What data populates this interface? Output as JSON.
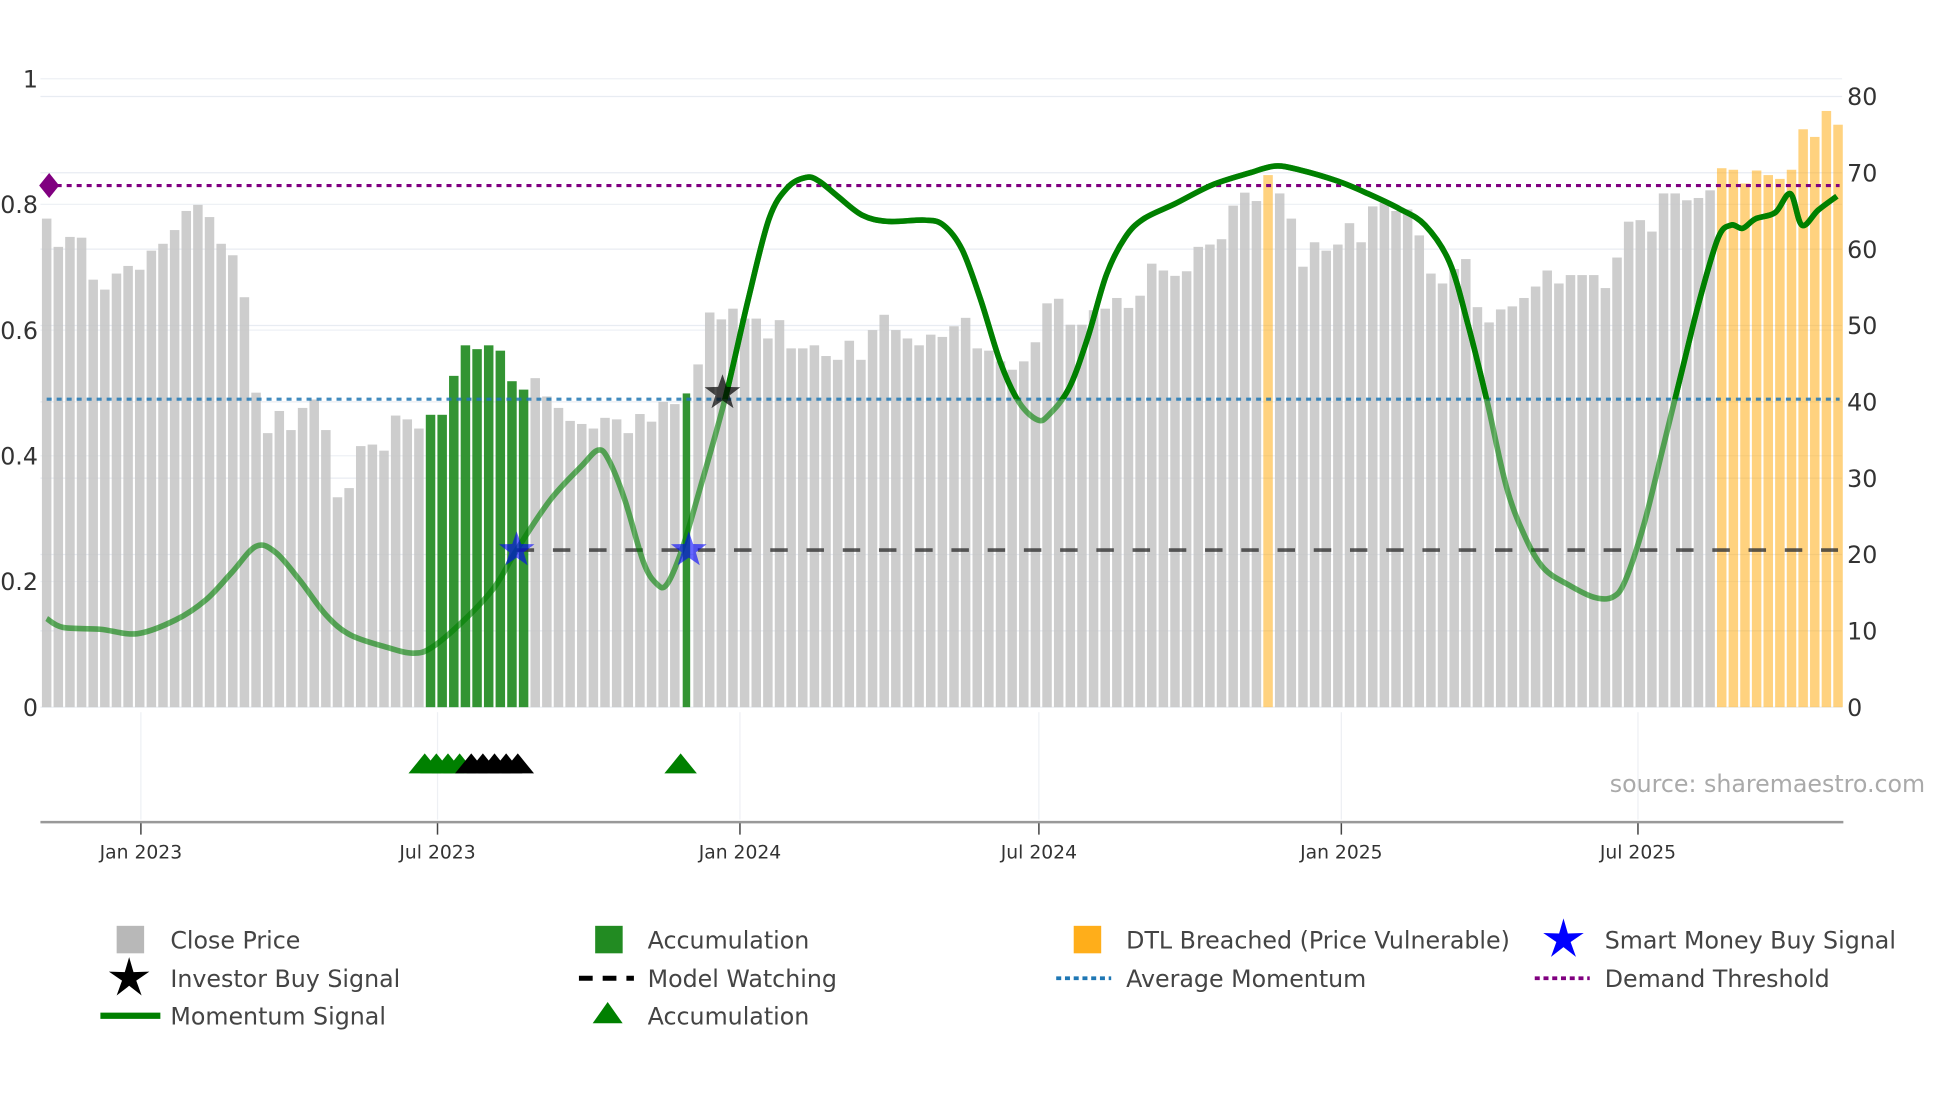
{
  "chart_data": {
    "type": "bar",
    "title": "",
    "xlabel": "",
    "ylabel_left": "",
    "ylabel_right": "",
    "source_note": "source: sharemaestro.com",
    "left_axis": {
      "range": [
        0,
        1
      ],
      "ticks": [
        "0",
        "0.2",
        "0.4",
        "0.6",
        "0.8",
        "1"
      ],
      "tick_values": [
        0,
        0.2,
        0.4,
        0.6,
        0.8,
        1
      ]
    },
    "right_axis": {
      "range": [
        0,
        80
      ],
      "ticks": [
        "0",
        "10",
        "20",
        "30",
        "40",
        "50",
        "60",
        "70",
        "80"
      ],
      "tick_values": [
        0,
        10,
        20,
        30,
        40,
        50,
        60,
        70,
        80
      ]
    },
    "x_axis": {
      "unit": "weekly bar index",
      "ticks": [
        {
          "label": "Jan 2023",
          "index": 8.1
        },
        {
          "label": "Jul 2023",
          "index": 33.6
        },
        {
          "label": "Jan 2024",
          "index": 59.6
        },
        {
          "label": "Jul 2024",
          "index": 85.3
        },
        {
          "label": "Jan 2025",
          "index": 111.3
        },
        {
          "label": "Jul 2025",
          "index": 136.8
        }
      ]
    },
    "close_price": [
      64.0,
      60.3,
      61.6,
      61.5,
      56.0,
      54.7,
      56.8,
      57.8,
      57.3,
      59.8,
      60.7,
      62.5,
      65.0,
      65.8,
      64.2,
      60.7,
      59.2,
      53.7,
      41.2,
      35.9,
      38.8,
      36.3,
      39.2,
      40.3,
      36.3,
      27.5,
      28.7,
      34.2,
      34.4,
      33.6,
      38.2,
      37.7,
      36.5,
      38.3,
      38.3,
      43.4,
      47.4,
      46.9,
      47.4,
      46.7,
      42.7,
      41.6,
      43.1,
      40.7,
      39.2,
      37.5,
      37.1,
      36.5,
      37.9,
      37.7,
      35.9,
      38.4,
      37.4,
      40.0,
      39.7,
      41.1,
      44.9,
      51.7,
      50.8,
      52.2,
      50.9,
      50.9,
      48.3,
      50.7,
      47.0,
      47.0,
      47.4,
      46.0,
      45.5,
      48.0,
      45.5,
      49.4,
      51.4,
      49.4,
      48.3,
      47.4,
      48.8,
      48.5,
      49.9,
      51.0,
      47.0,
      46.7,
      45.3,
      44.2,
      45.3,
      47.8,
      52.9,
      53.5,
      50.1,
      50.1,
      52.0,
      52.2,
      53.6,
      52.3,
      53.9,
      58.1,
      57.2,
      56.5,
      57.1,
      60.3,
      60.6,
      61.3,
      65.7,
      67.4,
      66.3,
      69.7,
      67.3,
      64.0,
      57.7,
      60.9,
      59.8,
      60.6,
      63.4,
      60.9,
      65.6,
      66.1,
      65.0,
      65.2,
      61.8,
      56.8,
      55.5,
      57.4,
      58.7,
      52.4,
      50.4,
      52.1,
      52.5,
      53.6,
      55.1,
      57.2,
      55.5,
      56.6,
      56.6,
      56.6,
      54.9,
      58.9,
      63.6,
      63.8,
      62.3,
      67.3,
      67.3,
      66.4,
      66.7,
      67.7,
      70.6,
      70.4,
      68.6,
      70.3,
      69.7,
      69.2,
      70.4,
      75.7,
      74.7,
      78.1,
      76.3
    ],
    "accumulation_bars": [
      33,
      34,
      35,
      36,
      37,
      38,
      39,
      40,
      41,
      55
    ],
    "dtl_breached_bars": [
      105,
      144,
      145,
      146,
      147,
      148,
      149,
      150,
      151,
      152,
      153,
      154
    ],
    "momentum_signal": [
      [
        0,
        0.141
      ],
      [
        1.4,
        0.127
      ],
      [
        4.6,
        0.124
      ],
      [
        7.8,
        0.117
      ],
      [
        11.1,
        0.139
      ],
      [
        13.7,
        0.171
      ],
      [
        15.9,
        0.214
      ],
      [
        18.0,
        0.256
      ],
      [
        19.7,
        0.246
      ],
      [
        21.8,
        0.201
      ],
      [
        24.0,
        0.147
      ],
      [
        26.1,
        0.115
      ],
      [
        29.3,
        0.095
      ],
      [
        31.5,
        0.086
      ],
      [
        33.1,
        0.095
      ],
      [
        35.8,
        0.137
      ],
      [
        38.5,
        0.191
      ],
      [
        40.4,
        0.25
      ],
      [
        43.3,
        0.33
      ],
      [
        46.0,
        0.384
      ],
      [
        47.4,
        0.409
      ],
      [
        48.3,
        0.394
      ],
      [
        49.7,
        0.33
      ],
      [
        51.3,
        0.231
      ],
      [
        52.4,
        0.197
      ],
      [
        53.3,
        0.195
      ],
      [
        54.6,
        0.25
      ],
      [
        56.2,
        0.35
      ],
      [
        58.3,
        0.489
      ],
      [
        60.3,
        0.648
      ],
      [
        62.1,
        0.777
      ],
      [
        63.7,
        0.827
      ],
      [
        65.3,
        0.843
      ],
      [
        66.4,
        0.837
      ],
      [
        68.0,
        0.813
      ],
      [
        70.1,
        0.783
      ],
      [
        72.3,
        0.773
      ],
      [
        75.5,
        0.775
      ],
      [
        77.1,
        0.767
      ],
      [
        78.7,
        0.728
      ],
      [
        80.3,
        0.648
      ],
      [
        82.0,
        0.548
      ],
      [
        83.6,
        0.485
      ],
      [
        85.2,
        0.457
      ],
      [
        86.2,
        0.466
      ],
      [
        87.9,
        0.508
      ],
      [
        89.5,
        0.588
      ],
      [
        91.1,
        0.688
      ],
      [
        92.7,
        0.747
      ],
      [
        94.3,
        0.777
      ],
      [
        97.0,
        0.801
      ],
      [
        100.2,
        0.831
      ],
      [
        103.4,
        0.85
      ],
      [
        105.6,
        0.861
      ],
      [
        107.7,
        0.855
      ],
      [
        111.0,
        0.837
      ],
      [
        113.6,
        0.817
      ],
      [
        116.3,
        0.793
      ],
      [
        118.5,
        0.767
      ],
      [
        120.6,
        0.708
      ],
      [
        122.2,
        0.608
      ],
      [
        123.8,
        0.489
      ],
      [
        125.5,
        0.35
      ],
      [
        127.1,
        0.271
      ],
      [
        128.7,
        0.221
      ],
      [
        130.8,
        0.195
      ],
      [
        133.0,
        0.175
      ],
      [
        134.6,
        0.175
      ],
      [
        135.7,
        0.201
      ],
      [
        137.3,
        0.29
      ],
      [
        138.9,
        0.409
      ],
      [
        140.5,
        0.529
      ],
      [
        142.1,
        0.648
      ],
      [
        143.7,
        0.747
      ],
      [
        144.8,
        0.767
      ],
      [
        145.8,
        0.762
      ],
      [
        146.9,
        0.777
      ],
      [
        148.6,
        0.787
      ],
      [
        149.9,
        0.817
      ],
      [
        150.9,
        0.767
      ],
      [
        152.3,
        0.791
      ],
      [
        153.9,
        0.813
      ]
    ],
    "average_momentum": 0.49,
    "demand_threshold": 0.83,
    "model_watching": {
      "value": 0.25,
      "from_index": 40.4,
      "to_index": 154
    },
    "smart_money_buy_signals": [
      [
        40.4,
        0.25
      ],
      [
        55.2,
        0.25
      ]
    ],
    "investor_buy_signals": [
      [
        58.1,
        0.5
      ]
    ],
    "accumulation_triangles_green": [
      32.5,
      33.5,
      34.5,
      35.5,
      54.5
    ],
    "accumulation_triangles_black": [
      36.5,
      37.5,
      38.5,
      39.5,
      40.5
    ],
    "colors": {
      "close_price": "#c4c4c4",
      "accumulation": "#228b22",
      "dtl_breached": "#ffa500",
      "momentum": "#008000",
      "average_momentum": "#1f77b4",
      "demand_threshold": "#800080",
      "model_watching": "#333333",
      "smart_money": "#0000ff",
      "investor": "#000000"
    },
    "legend": {
      "placement": "bottom",
      "items": [
        {
          "label": "Close Price",
          "symbol": "gray-square"
        },
        {
          "label": "Accumulation",
          "symbol": "green-square"
        },
        {
          "label": "DTL Breached (Price Vulnerable)",
          "symbol": "orange-square"
        },
        {
          "label": "Smart Money Buy Signal",
          "symbol": "blue-star"
        },
        {
          "label": "Investor Buy Signal",
          "symbol": "black-star"
        },
        {
          "label": "Model Watching",
          "symbol": "black-dash"
        },
        {
          "label": "Average Momentum",
          "symbol": "blue-dot"
        },
        {
          "label": "Demand Threshold",
          "symbol": "purple-dot"
        },
        {
          "label": "Momentum Signal",
          "symbol": "green-line"
        },
        {
          "label": "Accumulation",
          "symbol": "green-triangle"
        }
      ]
    }
  }
}
